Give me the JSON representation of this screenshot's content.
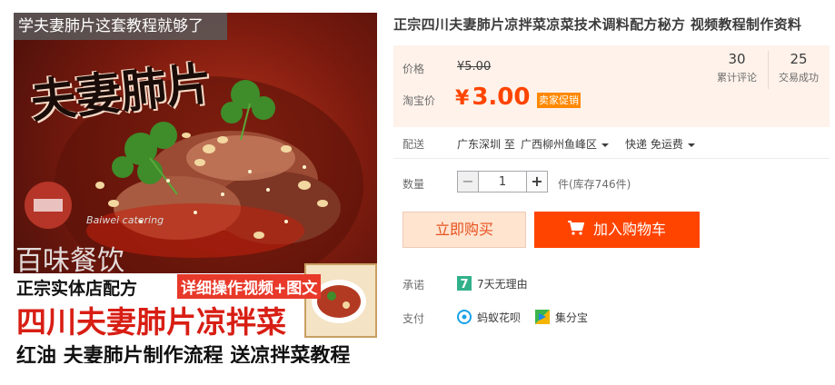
{
  "product": {
    "title": "正宗四川夫妻肺片凉拌菜凉菜技术调料配方秘方 视频教程制作资料"
  },
  "image": {
    "caption": "学夫妻肺片这套教程就够了",
    "title_art": "夫妻肺片",
    "logo_sub": "Baiwei catering",
    "logo": "百味餐饮",
    "tag1": "正宗实体店配方",
    "tag2": "详细操作视频+图文",
    "tag3": "四川夫妻肺片凉拌菜",
    "tag4": "红油 夫妻肺片制作流程 送凉拌菜教程"
  },
  "price": {
    "label": "价格",
    "original": "¥5.00",
    "taobao_label": "淘宝价",
    "currency": "¥",
    "promo_value": "3.00",
    "promo_badge": "卖家促销"
  },
  "stats": {
    "reviews_count": "30",
    "reviews_label": "累计评论",
    "sales_count": "25",
    "sales_label": "交易成功"
  },
  "shipping": {
    "label": "配送",
    "from": "广东深圳 至",
    "to": "广西柳州鱼峰区",
    "method": "快递 免运费"
  },
  "quantity": {
    "label": "数量",
    "minus": "−",
    "value": "1",
    "plus": "+",
    "stock": "件(库存746件)"
  },
  "actions": {
    "buy_now": "立即购买",
    "add_cart": "加入购物车"
  },
  "promise": {
    "label": "承诺",
    "item": "7天无理由",
    "icon_char": "7"
  },
  "payment": {
    "label": "支付",
    "method1": "蚂蚁花呗",
    "method2": "集分宝"
  },
  "colors": {
    "accent": "#ff4400",
    "price": "#ff4400",
    "badge": "#ff8800",
    "price_box_bg": "#fef2ea"
  },
  "icons": [
    "cart-icon",
    "seven-day-icon",
    "huabei-icon",
    "jifenbao-icon",
    "chevron-down-icon"
  ]
}
